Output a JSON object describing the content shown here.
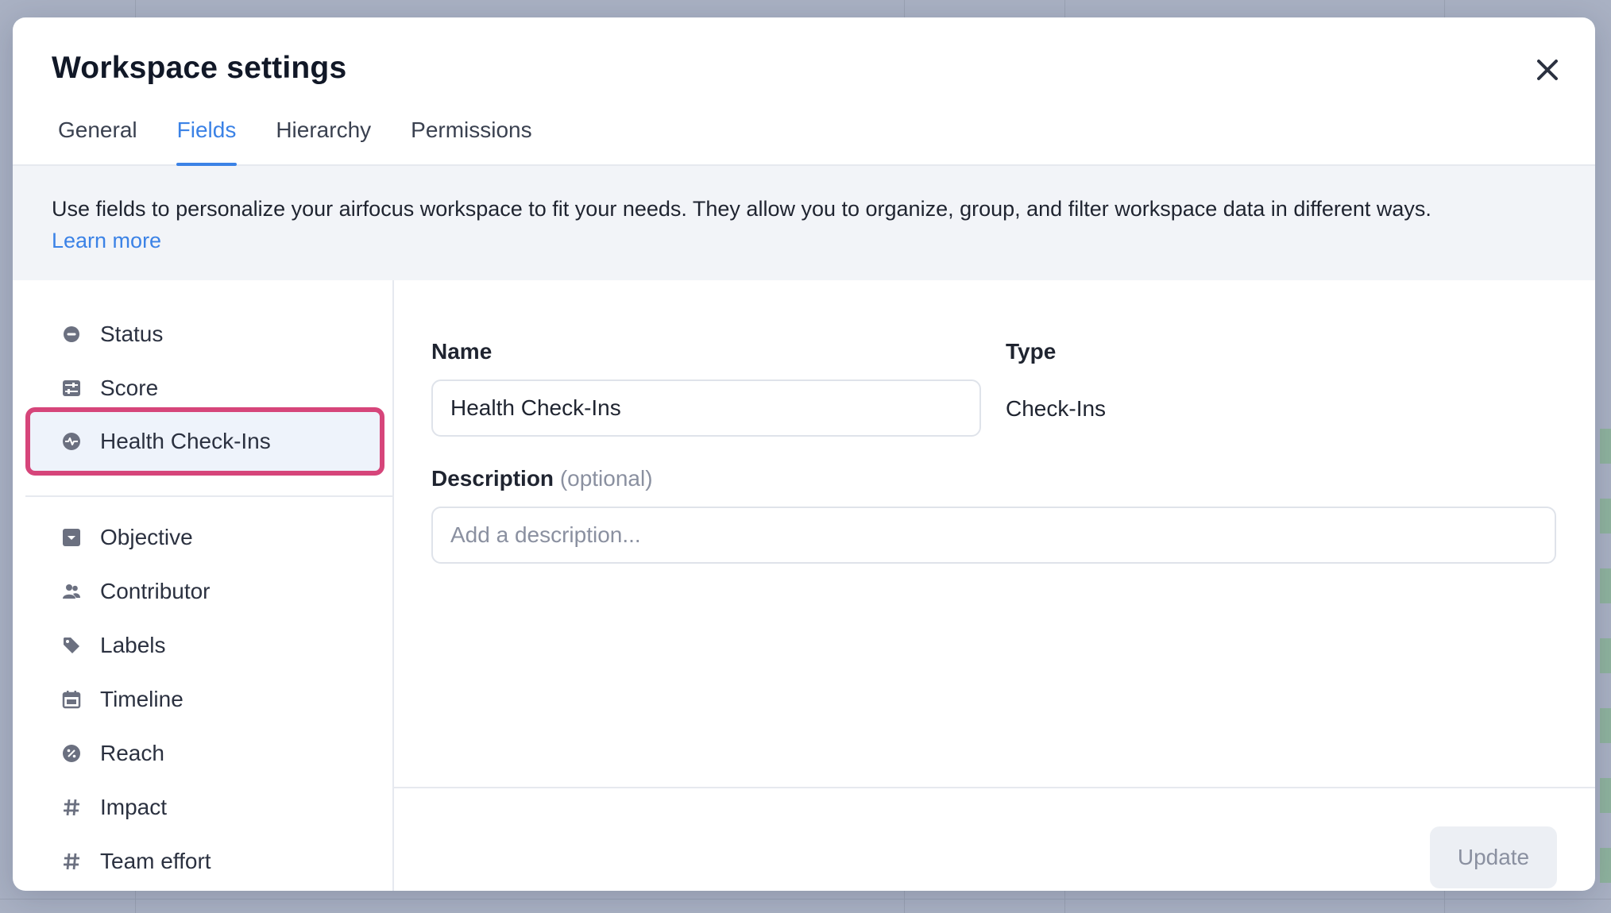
{
  "modal": {
    "title": "Workspace settings",
    "tabs": [
      {
        "label": "General"
      },
      {
        "label": "Fields",
        "active": true
      },
      {
        "label": "Hierarchy"
      },
      {
        "label": "Permissions"
      }
    ],
    "info": {
      "text": "Use fields to personalize your airfocus workspace to fit your needs. They allow you to organize, group, and filter workspace data in different ways.",
      "link_label": "Learn more"
    }
  },
  "sidebar": {
    "items": [
      {
        "label": "Status",
        "icon": "status-circle-icon"
      },
      {
        "label": "Score",
        "icon": "score-sliders-icon"
      },
      {
        "label": "Health Check-Ins",
        "icon": "pulse-icon",
        "selected": true
      },
      {
        "label": "Objective",
        "icon": "dropdown-box-icon"
      },
      {
        "label": "Contributor",
        "icon": "users-icon"
      },
      {
        "label": "Labels",
        "icon": "tag-icon"
      },
      {
        "label": "Timeline",
        "icon": "calendar-icon"
      },
      {
        "label": "Reach",
        "icon": "percent-icon"
      },
      {
        "label": "Impact",
        "icon": "hash-icon"
      },
      {
        "label": "Team effort",
        "icon": "hash-icon"
      }
    ]
  },
  "form": {
    "name_label": "Name",
    "name_value": "Health Check-Ins",
    "type_label": "Type",
    "type_value": "Check-Ins",
    "description_label": "Description",
    "description_optional": "(optional)",
    "description_placeholder": "Add a description...",
    "update_label": "Update"
  },
  "colors": {
    "accent": "#3b82e6",
    "highlight": "#d6457a",
    "selected_bg": "#eef3fb"
  }
}
